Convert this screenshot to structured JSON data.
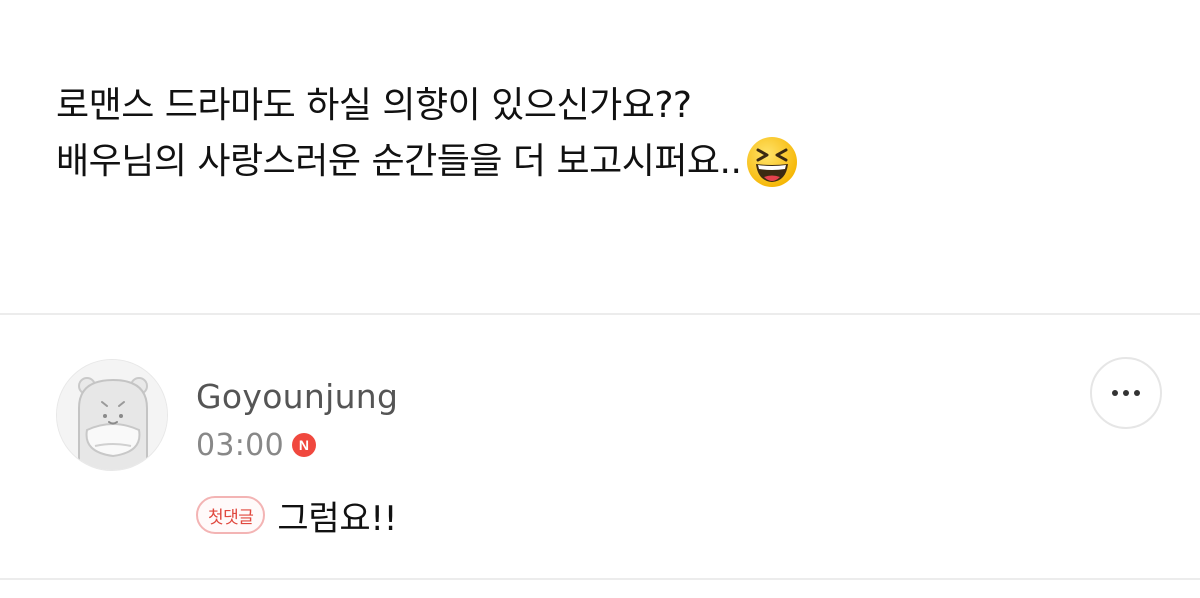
{
  "post": {
    "line1": "로맨스 드라마도 하실 의향이 있으신가요??",
    "line2": "배우님의 사랑스러운 순간들을 더 보고시퍼요..",
    "emoji": "grinning-squinting-face-emoji"
  },
  "comment": {
    "author": "Goyounjung",
    "time": "03:00",
    "new_badge": "N",
    "first_comment_badge": "첫댓글",
    "text": "그럼요!!",
    "avatar_icon": "hamster-avatar-icon",
    "more_icon": "more-dots-icon"
  },
  "colors": {
    "badge_red": "#f0483e",
    "first_badge_border": "#f3b4b4",
    "divider": "#ececec",
    "author_gray": "#555555",
    "time_gray": "#888888"
  }
}
